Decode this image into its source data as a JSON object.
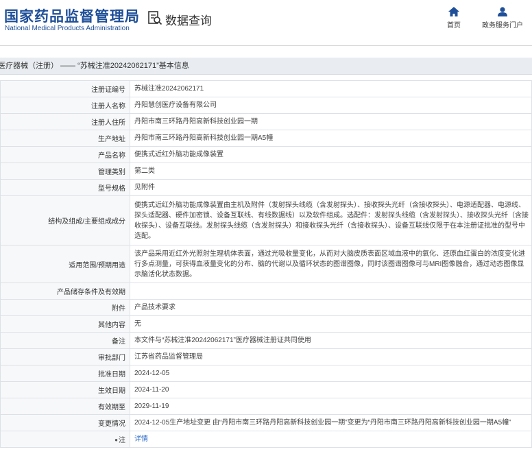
{
  "header": {
    "logo_cn": "国家药品监督管理局",
    "logo_en": "National Medical Products Administration",
    "query_label": "数据查询",
    "nav": [
      {
        "label": "首页",
        "icon": "home-icon"
      },
      {
        "label": "政务服务门户",
        "icon": "user-icon"
      }
    ]
  },
  "breadcrumb": "医疗器械（注册） —— “苏械注准20242062171”基本信息",
  "colors": {
    "brand": "#1f4f98",
    "link": "#2d6bc5",
    "breadcrumb_bg": "#e9edf1"
  },
  "rows": [
    {
      "label": "注册证编号",
      "value": "苏械注准20242062171"
    },
    {
      "label": "注册人名称",
      "value": "丹阳慧创医疗设备有限公司"
    },
    {
      "label": "注册人住所",
      "value": "丹阳市南三环路丹阳高新科技创业园一期"
    },
    {
      "label": "生产地址",
      "value": "丹阳市南三环路丹阳高新科技创业园一期A5幢"
    },
    {
      "label": "产品名称",
      "value": "便携式近红外脑功能成像装置"
    },
    {
      "label": "管理类别",
      "value": "第二类"
    },
    {
      "label": "型号规格",
      "value": "见附件"
    },
    {
      "label": "结构及组成/主要组成成分",
      "value": "便携式近红外脑功能成像装置由主机及附件（发射探头线缆（含发射探头）、接收探头光纤（含接收探头）、电源适配器、电源线、探头适配器、硬件加密锁、设备互联线、有线数据线）以及软件组成。选配件：发射探头线缆（含发射探头）、接收探头光纤（含接收探头）、设备互联线。发射探头线缆（含发射探头）和接收探头光纤（含接收探头）、设备互联线仅限于在本注册证批准的型号中选配。"
    },
    {
      "label": "适用范围/预期用途",
      "value": "该产品采用近红外光照射生理机体表面，通过光吸收量变化，从而对大脑皮质表面区域血液中的氧化、还原血红蛋白的浓度变化进行多点测量，可获得血液量变化的分布、脑的代谢以及循环状态的图谱图像，同时该图谱图像可与MRI图像融合，通过动态图像显示脑活化状态数据。"
    },
    {
      "label": "产品储存条件及有效期",
      "value": ""
    },
    {
      "label": "附件",
      "value": "产品技术要求"
    },
    {
      "label": "其他内容",
      "value": "无"
    },
    {
      "label": "备注",
      "value": "本文件与“苏械注准20242062171”医疗器械注册证共同使用"
    },
    {
      "label": "审批部门",
      "value": "江苏省药品监督管理局"
    },
    {
      "label": "批准日期",
      "value": "2024-12-05"
    },
    {
      "label": "生效日期",
      "value": "2024-11-20"
    },
    {
      "label": "有效期至",
      "value": "2029-11-19"
    },
    {
      "label": "变更情况",
      "value": "2024-12-05生产地址变更 由“丹阳市南三环路丹阳高新科技创业园一期”变更为“丹阳市南三环路丹阳高新科技创业园一期A5幢”"
    },
    {
      "label": "注",
      "value": "详情",
      "link": true
    }
  ]
}
